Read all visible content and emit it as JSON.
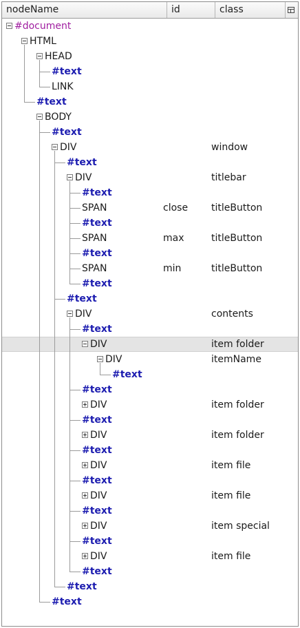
{
  "columns": {
    "nodeName": "nodeName",
    "id": "id",
    "class": "class"
  },
  "column_picker_icon": "column-picker-icon",
  "rows": [
    {
      "name": "#document",
      "kind": "doc",
      "depth": 0,
      "twisty": "open",
      "id": "",
      "class": ""
    },
    {
      "name": "HTML",
      "kind": "el",
      "depth": 1,
      "twisty": "open",
      "id": "",
      "class": ""
    },
    {
      "name": "HEAD",
      "kind": "el",
      "depth": 2,
      "twisty": "open",
      "id": "",
      "class": ""
    },
    {
      "name": "#text",
      "kind": "text",
      "depth": 3,
      "twisty": "none",
      "id": "",
      "class": ""
    },
    {
      "name": "LINK",
      "kind": "el",
      "depth": 3,
      "twisty": "none",
      "id": "",
      "class": ""
    },
    {
      "name": "#text",
      "kind": "text",
      "depth": 2,
      "twisty": "none",
      "id": "",
      "class": ""
    },
    {
      "name": "BODY",
      "kind": "el",
      "depth": 2,
      "twisty": "open",
      "id": "",
      "class": ""
    },
    {
      "name": "#text",
      "kind": "text",
      "depth": 3,
      "twisty": "none",
      "id": "",
      "class": ""
    },
    {
      "name": "DIV",
      "kind": "el",
      "depth": 3,
      "twisty": "open",
      "id": "",
      "class": "window"
    },
    {
      "name": "#text",
      "kind": "text",
      "depth": 4,
      "twisty": "none",
      "id": "",
      "class": ""
    },
    {
      "name": "DIV",
      "kind": "el",
      "depth": 4,
      "twisty": "open",
      "id": "",
      "class": "titlebar"
    },
    {
      "name": "#text",
      "kind": "text",
      "depth": 5,
      "twisty": "none",
      "id": "",
      "class": ""
    },
    {
      "name": "SPAN",
      "kind": "el",
      "depth": 5,
      "twisty": "none",
      "id": "close",
      "class": "titleButton"
    },
    {
      "name": "#text",
      "kind": "text",
      "depth": 5,
      "twisty": "none",
      "id": "",
      "class": ""
    },
    {
      "name": "SPAN",
      "kind": "el",
      "depth": 5,
      "twisty": "none",
      "id": "max",
      "class": "titleButton"
    },
    {
      "name": "#text",
      "kind": "text",
      "depth": 5,
      "twisty": "none",
      "id": "",
      "class": ""
    },
    {
      "name": "SPAN",
      "kind": "el",
      "depth": 5,
      "twisty": "none",
      "id": "min",
      "class": "titleButton"
    },
    {
      "name": "#text",
      "kind": "text",
      "depth": 5,
      "twisty": "none",
      "id": "",
      "class": ""
    },
    {
      "name": "#text",
      "kind": "text",
      "depth": 4,
      "twisty": "none",
      "id": "",
      "class": ""
    },
    {
      "name": "DIV",
      "kind": "el",
      "depth": 4,
      "twisty": "open",
      "id": "",
      "class": "contents"
    },
    {
      "name": "#text",
      "kind": "text",
      "depth": 5,
      "twisty": "none",
      "id": "",
      "class": ""
    },
    {
      "name": "DIV",
      "kind": "el",
      "depth": 5,
      "twisty": "open",
      "id": "",
      "class": "item folder",
      "selected": true
    },
    {
      "name": "DIV",
      "kind": "el",
      "depth": 6,
      "twisty": "open",
      "id": "",
      "class": "itemName"
    },
    {
      "name": "#text",
      "kind": "text",
      "depth": 7,
      "twisty": "none",
      "id": "",
      "class": ""
    },
    {
      "name": "#text",
      "kind": "text",
      "depth": 5,
      "twisty": "none",
      "id": "",
      "class": ""
    },
    {
      "name": "DIV",
      "kind": "el",
      "depth": 5,
      "twisty": "closed",
      "id": "",
      "class": "item folder"
    },
    {
      "name": "#text",
      "kind": "text",
      "depth": 5,
      "twisty": "none",
      "id": "",
      "class": ""
    },
    {
      "name": "DIV",
      "kind": "el",
      "depth": 5,
      "twisty": "closed",
      "id": "",
      "class": "item folder"
    },
    {
      "name": "#text",
      "kind": "text",
      "depth": 5,
      "twisty": "none",
      "id": "",
      "class": ""
    },
    {
      "name": "DIV",
      "kind": "el",
      "depth": 5,
      "twisty": "closed",
      "id": "",
      "class": "item file"
    },
    {
      "name": "#text",
      "kind": "text",
      "depth": 5,
      "twisty": "none",
      "id": "",
      "class": ""
    },
    {
      "name": "DIV",
      "kind": "el",
      "depth": 5,
      "twisty": "closed",
      "id": "",
      "class": "item file"
    },
    {
      "name": "#text",
      "kind": "text",
      "depth": 5,
      "twisty": "none",
      "id": "",
      "class": ""
    },
    {
      "name": "DIV",
      "kind": "el",
      "depth": 5,
      "twisty": "closed",
      "id": "",
      "class": "item special"
    },
    {
      "name": "#text",
      "kind": "text",
      "depth": 5,
      "twisty": "none",
      "id": "",
      "class": ""
    },
    {
      "name": "DIV",
      "kind": "el",
      "depth": 5,
      "twisty": "closed",
      "id": "",
      "class": "item file"
    },
    {
      "name": "#text",
      "kind": "text",
      "depth": 5,
      "twisty": "none",
      "id": "",
      "class": ""
    },
    {
      "name": "#text",
      "kind": "text",
      "depth": 4,
      "twisty": "none",
      "id": "",
      "class": ""
    },
    {
      "name": "#text",
      "kind": "text",
      "depth": 3,
      "twisty": "none",
      "id": "",
      "class": ""
    }
  ]
}
